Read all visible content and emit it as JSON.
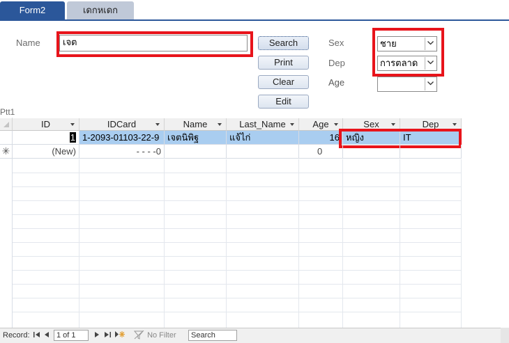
{
  "tabs": [
    {
      "label": "Form2"
    },
    {
      "label": "เดกหเดก"
    }
  ],
  "form": {
    "name_label": "Name",
    "name_value": "เจต",
    "sex_label": "Sex",
    "sex_value": "ชาย",
    "dep_label": "Dep",
    "dep_value": "การตลาด",
    "age_label": "Age",
    "age_value": ""
  },
  "buttons": {
    "search": "Search",
    "print": "Print",
    "clear": "Clear",
    "edit": "Edit"
  },
  "datasheet": {
    "title": "Ptt1",
    "columns": [
      "ID",
      "IDCard",
      "Name",
      "Last_Name",
      "Age",
      "Sex",
      "Dep"
    ],
    "rows": [
      {
        "id": "1",
        "idcard": "1-2093-01103-22-9",
        "name": "เจตนิพิฐ",
        "last_name": "แจ้ไก่",
        "age": "16",
        "sex": "หญิง",
        "dep": "IT"
      }
    ],
    "new_row": {
      "id": "(New)",
      "idcard": "-   -      -   -0",
      "age": "0"
    }
  },
  "status": {
    "record_label": "Record:",
    "position": "1 of 1",
    "filter": "No Filter",
    "search_placeholder": "Search"
  },
  "colors": {
    "accent": "#2b579a",
    "highlight": "#e8141b",
    "selected_row": "#a9cdf0"
  }
}
